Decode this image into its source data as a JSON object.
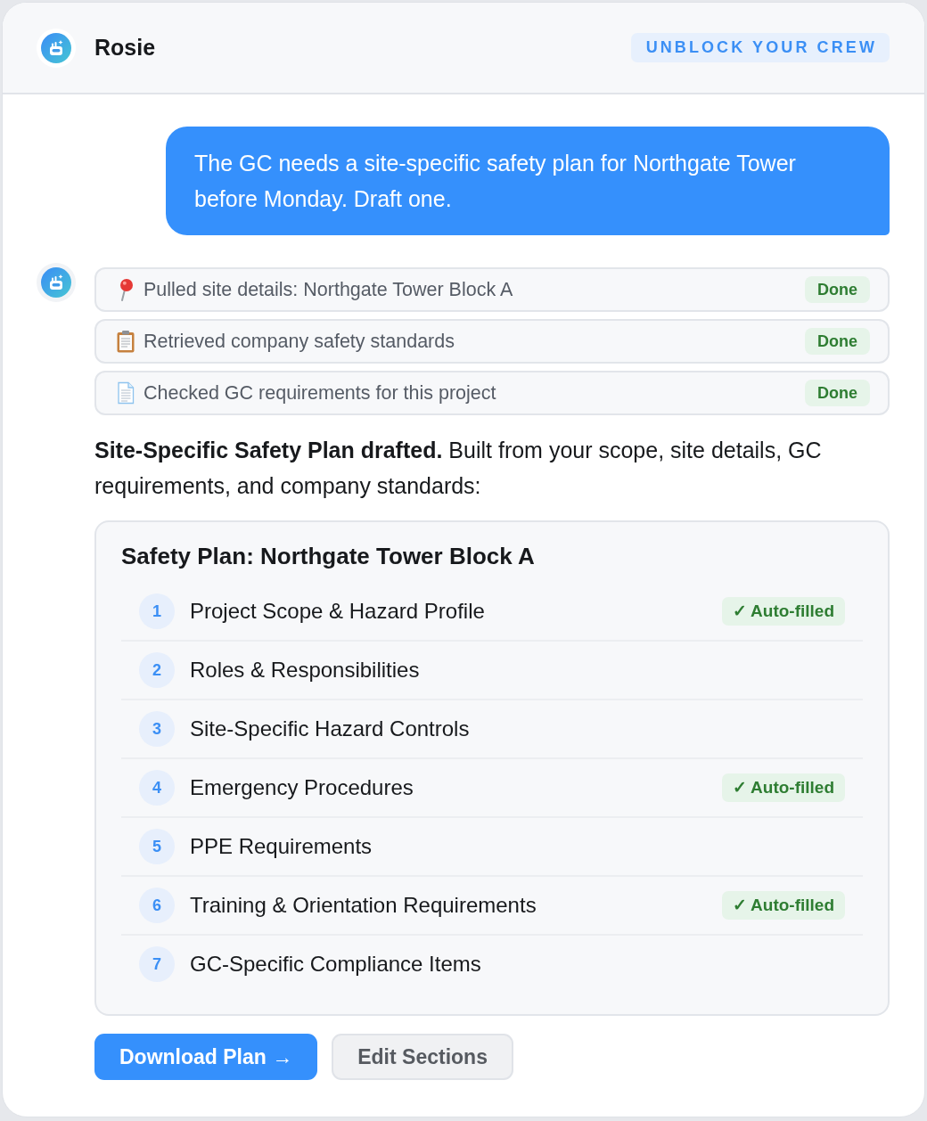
{
  "header": {
    "title": "Rosie",
    "badge": "UNBLOCK YOUR CREW"
  },
  "user_message": {
    "text": "The GC needs a site-specific safety plan for Northgate Tower before Monday. Draft one."
  },
  "steps": [
    {
      "kind": "site",
      "text": "Pulled site details: Northgate Tower Block A",
      "status": "Done"
    },
    {
      "kind": "standards",
      "text": "Retrieved company safety standards",
      "status": "Done"
    },
    {
      "kind": "requirements",
      "text": "Checked GC requirements for this project",
      "status": "Done"
    }
  ],
  "summary": "**Site-Specific Safety Plan drafted.** Built from your scope, site details, GC requirements, and company standards:",
  "plan": {
    "title": "Safety Plan: Northgate Tower Block A",
    "sections": [
      {
        "number": "1",
        "title": "Project Scope & Hazard Profile",
        "badge": "✓ Auto-filled"
      },
      {
        "number": "2",
        "title": "Roles & Responsibilities"
      },
      {
        "number": "3",
        "title": "Site-Specific Hazard Controls"
      },
      {
        "number": "4",
        "title": "Emergency Procedures",
        "badge": "✓ Auto-filled"
      },
      {
        "number": "5",
        "title": "PPE Requirements"
      },
      {
        "number": "6",
        "title": "Training & Orientation Requirements",
        "badge": "✓ Auto-filled"
      },
      {
        "number": "7",
        "title": "GC-Specific Compliance Items"
      }
    ]
  },
  "actions": [
    {
      "kind": "primary",
      "label": "Download Plan →"
    },
    {
      "kind": "secondary",
      "label": "Edit Sections"
    }
  ]
}
